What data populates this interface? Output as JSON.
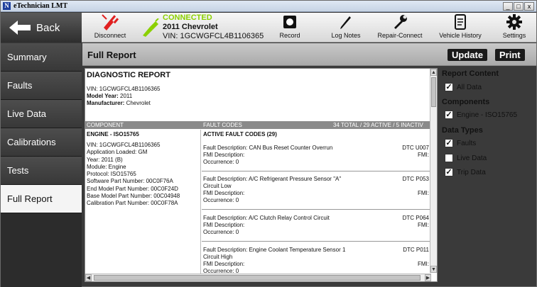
{
  "window": {
    "title": "eTechnician LMT",
    "minimize": "_",
    "restore": "□",
    "close": "x"
  },
  "toolbar": {
    "back_label": "Back",
    "disconnect_label": "Disconnect",
    "connection": {
      "status": "CONNECTED",
      "vehicle": "2011 Chevrolet",
      "vin": "VIN: 1GCWGFCL4B1106365"
    },
    "record_label": "Record",
    "log_notes_label": "Log Notes",
    "repair_connect_label": "Repair-Connect",
    "vehicle_history_label": "Vehicle History",
    "settings_label": "Settings",
    "colors": {
      "connected": "#8bd000",
      "disconnect": "#e02020"
    }
  },
  "nav": {
    "items": [
      "Summary",
      "Faults",
      "Live Data",
      "Calibrations",
      "Tests",
      "Full Report"
    ],
    "active": "Full Report"
  },
  "main": {
    "heading": "Full Report",
    "update_label": "Update",
    "print_label": "Print"
  },
  "report": {
    "title": "DIAGNOSTIC REPORT",
    "vin_label": "VIN:",
    "vin": "1GCWGFCL4B1106365",
    "model_year_label": "Model Year:",
    "model_year": "2011",
    "manufacturer_label": "Manufacturer:",
    "manufacturer": "Chevrolet",
    "col_component": "COMPONENT",
    "col_fault_codes": "FAULT CODES",
    "col_summary": "34 TOTAL / 29 ACTIVE / 5 INACTIV",
    "component_name": "ENGINE - ISO15765",
    "active_codes_label": "ACTIVE FAULT CODES (29)",
    "component_details": [
      "VIN: 1GCWGFCL4B1106365",
      "Application Loaded: GM",
      "Year: 2011 (B)",
      "Module: Engine",
      "Protocol: ISO15765",
      "Software Part Number: 00C0F76A",
      "End Model Part Number: 00C0F24D",
      "Base Model Part Number: 00C04948",
      "Calibration Part Number: 00C0F78A"
    ],
    "faults": [
      {
        "description": "Fault Description: CAN Bus Reset Counter Overrun",
        "line2": "",
        "fmi": "FMI Description:",
        "occurrence": "Occurrence: 0",
        "dtc": "DTC U007",
        "fmi_right": "FMI:"
      },
      {
        "description": "Fault Description: A/C Refrigerant Pressure Sensor \"A\"",
        "line2": "Circuit Low",
        "fmi": "FMI Description:",
        "occurrence": "Occurrence: 0",
        "dtc": "DTC P053",
        "fmi_right": "FMI:"
      },
      {
        "description": "Fault Description: A/C Clutch Relay Control Circuit",
        "line2": "",
        "fmi": "FMI Description:",
        "occurrence": "Occurrence: 0",
        "dtc": "DTC P064",
        "fmi_right": "FMI:"
      },
      {
        "description": "Fault Description: Engine Coolant Temperature Sensor 1",
        "line2": "Circuit High",
        "fmi": "FMI Description:",
        "occurrence": "Occurrence: 0",
        "dtc": "DTC P011",
        "fmi_right": "FMI:"
      }
    ]
  },
  "side": {
    "report_content_label": "Report Content",
    "all_data_label": "All Data",
    "all_data_checked": true,
    "components_label": "Components",
    "engine_label": "Engine - ISO15765",
    "engine_checked": true,
    "data_types_label": "Data Types",
    "faults_label": "Faults",
    "faults_checked": true,
    "live_data_label": "Live Data",
    "live_data_checked": false,
    "trip_data_label": "Trip Data",
    "trip_data_checked": true
  }
}
